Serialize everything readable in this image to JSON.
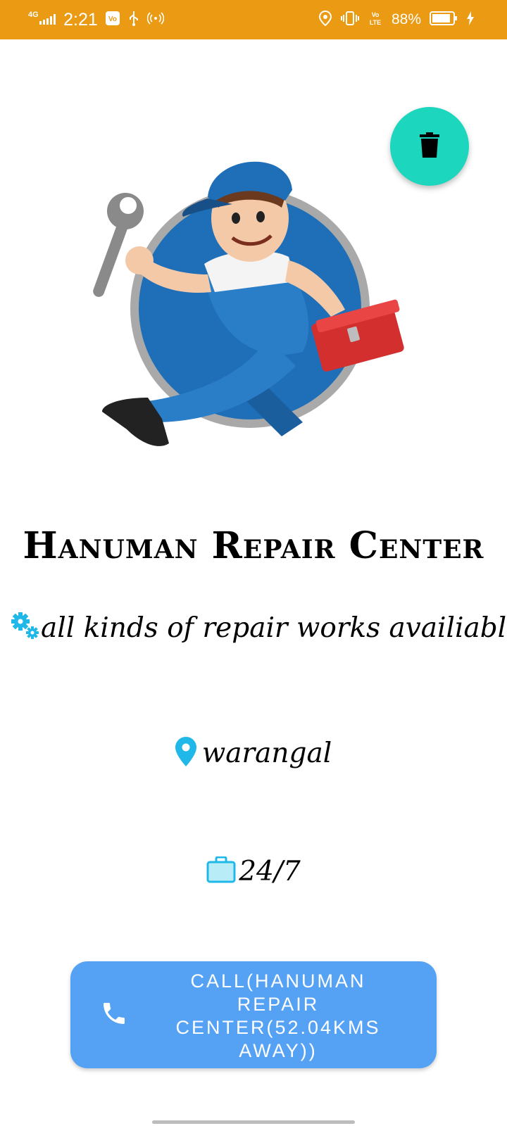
{
  "status_bar": {
    "network": "4G",
    "time": "2:21",
    "battery_pct": "88%",
    "icons": [
      "signal-icon",
      "notification-icon",
      "usb-icon",
      "hotspot-icon",
      "location-icon",
      "vibrate-icon",
      "volte-icon",
      "battery-icon",
      "charging-icon"
    ],
    "background": "#EA9A13"
  },
  "fab": {
    "icon": "trash-icon",
    "color": "#1DD6BE"
  },
  "illustration": {
    "icon": "repairman-mascot-icon"
  },
  "shop": {
    "name": "Hanuman Repair Center",
    "description": "all kinds of repair works availiable",
    "description_icon": "gears-icon",
    "location": "warangal",
    "location_icon": "map-pin-icon",
    "hours": "24/7",
    "hours_icon": "briefcase-icon",
    "icon_color": "#1FB8E8"
  },
  "call_button": {
    "label": "CALL(HANUMAN REPAIR CENTER(52.04KMS AWAY))",
    "icon": "phone-icon",
    "color": "#55A2F4"
  }
}
